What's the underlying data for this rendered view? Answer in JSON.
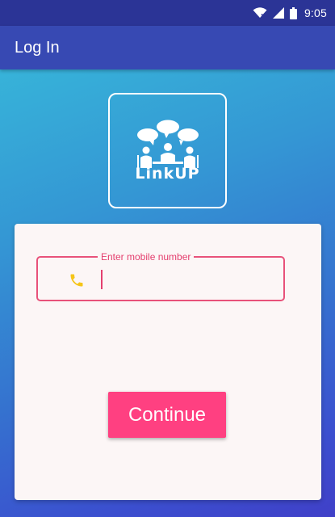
{
  "status_bar": {
    "time": "9:05",
    "icons": [
      "wifi-icon",
      "signal-icon",
      "battery-icon"
    ]
  },
  "app_bar": {
    "title": "Log In"
  },
  "logo": {
    "text": "LinkUP",
    "icon": "people-chat-icon"
  },
  "form": {
    "mobile_label": "Enter mobile number",
    "mobile_value": "",
    "mobile_icon": "phone-icon",
    "continue_label": "Continue"
  },
  "colors": {
    "status_bar": "#2b3496",
    "app_bar": "#3749b3",
    "accent": "#ff4081",
    "field_border": "#e8527a",
    "phone_icon": "#f5c518",
    "card": "#fcf6f6"
  }
}
